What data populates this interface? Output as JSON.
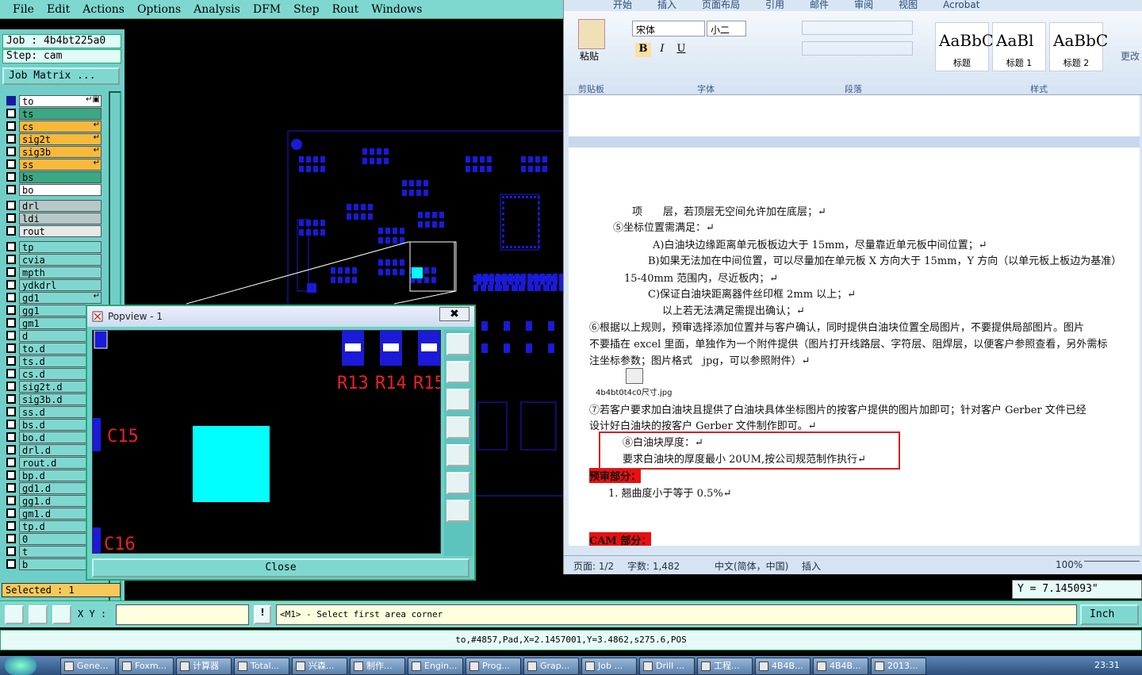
{
  "cam": {
    "menu": [
      "File",
      "Edit",
      "Actions",
      "Options",
      "Analysis",
      "DFM",
      "Step",
      "Rout",
      "Windows"
    ],
    "job": "Job : 4b4bt225a0",
    "step": "Step: cam",
    "job_matrix": "Job Matrix ...",
    "layers": [
      {
        "name": "to",
        "color": "#ffffff",
        "mark": "↵▣",
        "sel": true
      },
      {
        "name": "ts",
        "color": "#3aa882"
      },
      {
        "name": "cs",
        "color": "#f7b93a",
        "mark": "↵"
      },
      {
        "name": "sig2t",
        "color": "#f7b93a",
        "mark": "↵"
      },
      {
        "name": "sig3b",
        "color": "#f7b93a",
        "mark": "↵"
      },
      {
        "name": "ss",
        "color": "#f7b93a",
        "mark": "↵"
      },
      {
        "name": "bs",
        "color": "#3aa882"
      },
      {
        "name": "bo",
        "color": "#ffffff"
      },
      {
        "name": "drl",
        "color": "#b6c8c8",
        "gap": true
      },
      {
        "name": "ldi",
        "color": "#b6c8c8"
      },
      {
        "name": "rout",
        "color": "#e8e8e8"
      },
      {
        "name": "tp",
        "color": "#7fd8d0",
        "gap": true
      },
      {
        "name": "cvia",
        "color": "#7fd8d0"
      },
      {
        "name": "mpth",
        "color": "#7fd8d0"
      },
      {
        "name": "ydkdrl",
        "color": "#7fd8d0"
      },
      {
        "name": "gd1",
        "color": "#7fd8d0",
        "mark": "↵"
      },
      {
        "name": "gg1",
        "color": "#7fd8d0"
      },
      {
        "name": "gm1",
        "color": "#7fd8d0"
      },
      {
        "name": "d",
        "color": "#7fd8d0"
      },
      {
        "name": "to.d",
        "color": "#7fd8d0"
      },
      {
        "name": "ts.d",
        "color": "#7fd8d0"
      },
      {
        "name": "cs.d",
        "color": "#7fd8d0"
      },
      {
        "name": "sig2t.d",
        "color": "#7fd8d0"
      },
      {
        "name": "sig3b.d",
        "color": "#7fd8d0"
      },
      {
        "name": "ss.d",
        "color": "#7fd8d0"
      },
      {
        "name": "bs.d",
        "color": "#7fd8d0"
      },
      {
        "name": "bo.d",
        "color": "#7fd8d0"
      },
      {
        "name": "drl.d",
        "color": "#7fd8d0"
      },
      {
        "name": "rout.d",
        "color": "#7fd8d0"
      },
      {
        "name": "bp.d",
        "color": "#7fd8d0"
      },
      {
        "name": "gd1.d",
        "color": "#7fd8d0"
      },
      {
        "name": "gg1.d",
        "color": "#7fd8d0"
      },
      {
        "name": "gm1.d",
        "color": "#7fd8d0"
      },
      {
        "name": "tp.d",
        "color": "#7fd8d0"
      },
      {
        "name": "0",
        "color": "#7fd8d0"
      },
      {
        "name": "t",
        "color": "#7fd8d0"
      },
      {
        "name": "b",
        "color": "#7fd8d0"
      }
    ],
    "selected": "Selected : 1",
    "popview": {
      "title": "Popview - 1",
      "close_x": "✖",
      "close": "Close",
      "labels": [
        "R13",
        "R14",
        "R15",
        "C15",
        "C16"
      ]
    },
    "cmd": {
      "xy_label": "X Y :",
      "xy_value": "",
      "prompt": "<M1> - Select first area corner",
      "unit": "Inch"
    },
    "status": "to,#4857,Pad,X=2.1457001,Y=3.4862,s275.6,POS",
    "y_readout": "Y = 7.145093\"",
    "colors": {
      "pad": "#1a1ad8",
      "label": "#e8202a",
      "highlight": "#00ffff",
      "bg": "#000000"
    }
  },
  "word": {
    "tabs": [
      "开始",
      "插入",
      "页面布局",
      "引用",
      "邮件",
      "审阅",
      "视图",
      "Acrobat"
    ],
    "paste": "粘贴",
    "font_name": "宋体",
    "font_size": "小二",
    "groups": [
      "剪贴板",
      "字体",
      "段落",
      "样式"
    ],
    "styles": [
      {
        "sample": "AaBbC",
        "name": "标题"
      },
      {
        "sample": "AaBl",
        "name": "标题 1"
      },
      {
        "sample": "AaBbC",
        "name": "标题 2"
      }
    ],
    "change": "更改",
    "lines": [
      "项　　层，若顶层无空间允许加在底层；↵",
      "⑤坐标位置需满足：↵",
      "A)白油块边缘距离单元板板边大于 15mm，尽量靠近单元板中间位置；↵",
      "B)如果无法加在中间位置，可以尽量加在单元板 X 方向大于 15mm，Y 方向（以单元板上板边为基准）",
      "15-40mm 范围内，尽近板内；↵",
      "C)保证白油块距离器件丝印框 2mm 以上；↵",
      "以上若无法满足需提出确认；↵",
      "⑥根据以上规则，预审选择添加位置并与客户确认，同时提供白油块位置全局图片，不要提供局部图片。图片",
      "不要插在 excel 里面，单独作为一个附件提供（图片打开线路层、字符层、阻焊层，以便客户参照查看，另外需标",
      "注坐标参数；图片格式　jpg，可以参照附件）↵",
      "4b4bt0t4c0尺寸.jpg",
      "⑦若客户要求加白油块且提供了白油块具体坐标图片的按客户提供的图片加即可；针对客户 Gerber 文件已经",
      "设计好白油块的按客户 Gerber 文件制作即可。↵",
      "⑧白油块厚度：↵",
      "要求白油块的厚度最小 20UM,按公司规范制作执行↵",
      "预审部分：",
      "1. 翘曲度小于等于 0.5%↵",
      "CAM 部分："
    ],
    "status": {
      "page": "页面: 1/2",
      "words": "字数: 1,482",
      "lang": "中文(简体，中国)",
      "mode": "插入",
      "zoom": "100%"
    }
  },
  "taskbar": {
    "items": [
      "Gene...",
      "Foxm...",
      "计算器",
      "Total...",
      "兴森...",
      "制作...",
      "Engin...",
      "Prog...",
      "Grap...",
      "Job ...",
      "Drill ...",
      "工程...",
      "4B4B...",
      "4B4B...",
      "2013..."
    ],
    "time": "23:31"
  }
}
